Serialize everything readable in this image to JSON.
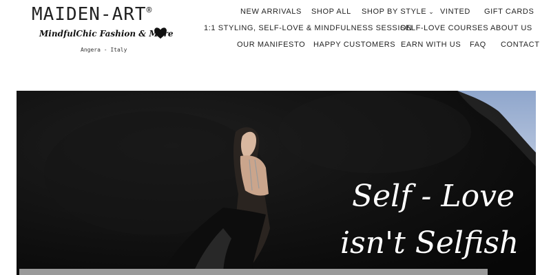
{
  "brand": {
    "name": "MAIDEN-ART",
    "reg_mark": "®",
    "tagline": "MindfulChic Fashion & More",
    "location": "Angera - Italy"
  },
  "nav": {
    "row1": [
      "NEW ARRIVALS",
      "SHOP ALL",
      "SHOP BY STYLE",
      "VINTED",
      "GIFT CARDS"
    ],
    "row2": [
      "1:1 STYLING, SELF-LOVE & MINDFULNESS SESSION",
      "SELF-LOVE COURSES",
      "ABOUT US"
    ],
    "row3": [
      "OUR MANIFESTO",
      "HAPPY CUSTOMERS",
      "EARN WITH US",
      "FAQ",
      "CONTACT"
    ],
    "dropdown_icon": "chevron-down-icon"
  },
  "hero": {
    "headline_line1": "Self - Love",
    "headline_line2": "isn't Selfish"
  },
  "colors": {
    "text": "#222222",
    "hero_bg": "#0b0b0b",
    "sky": "#9fb3d4",
    "bar": "#9a9a9a"
  }
}
